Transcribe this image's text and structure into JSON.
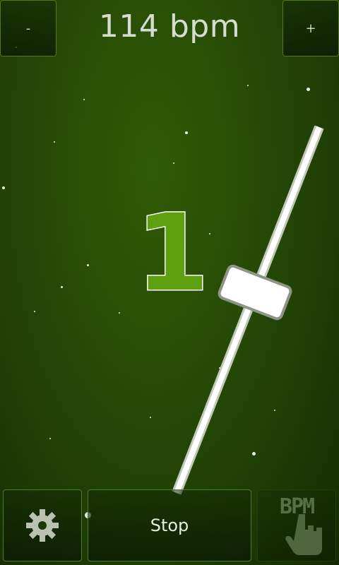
{
  "header": {
    "decrement_label": "-",
    "tempo_text": "114 bpm",
    "increment_label": "+"
  },
  "beat": {
    "current": "1"
  },
  "pendulum": {
    "tempo_bpm": 114
  },
  "controls": {
    "settings_icon": "gear-icon",
    "stop_label": "Stop",
    "tap_tempo_label": "BPM",
    "tap_icon": "hand-pointer-icon"
  },
  "colors": {
    "background": "#284d06",
    "beat_fill": "#5fa010",
    "button_border": "#4f7a24"
  }
}
